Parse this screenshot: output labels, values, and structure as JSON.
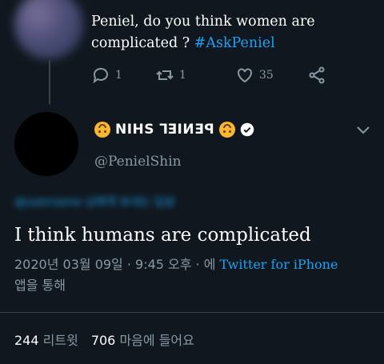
{
  "prev_tweet": {
    "text": "Peniel, do you think women are complicated ? ",
    "hashtag": "#AskPeniel",
    "reply_count": "1",
    "retweet_count": "1",
    "like_count": "35"
  },
  "tweet": {
    "display_name": "NIHS ꓶƎIИƎꟼ",
    "handle": "@PenielShin",
    "reply_to": "@username 님에게 보내는 답글",
    "text": "I think humans are complicated",
    "date_time": "2020년 03월 09일 · 9:45 오후 · 에 ",
    "source": "Twitter for iPhone",
    "source_suffix": "앱을 통해",
    "retweets": "244",
    "retweets_label": "리트윗",
    "likes": "706",
    "likes_label": "마음에 들어요"
  },
  "icons": [
    "reply-icon",
    "retweet-icon",
    "like-icon",
    "share-icon",
    "verified-icon",
    "chevron-down-icon"
  ],
  "colors": {
    "background": "#10171e",
    "accent": "#1da1f2",
    "muted": "#8899a6"
  }
}
